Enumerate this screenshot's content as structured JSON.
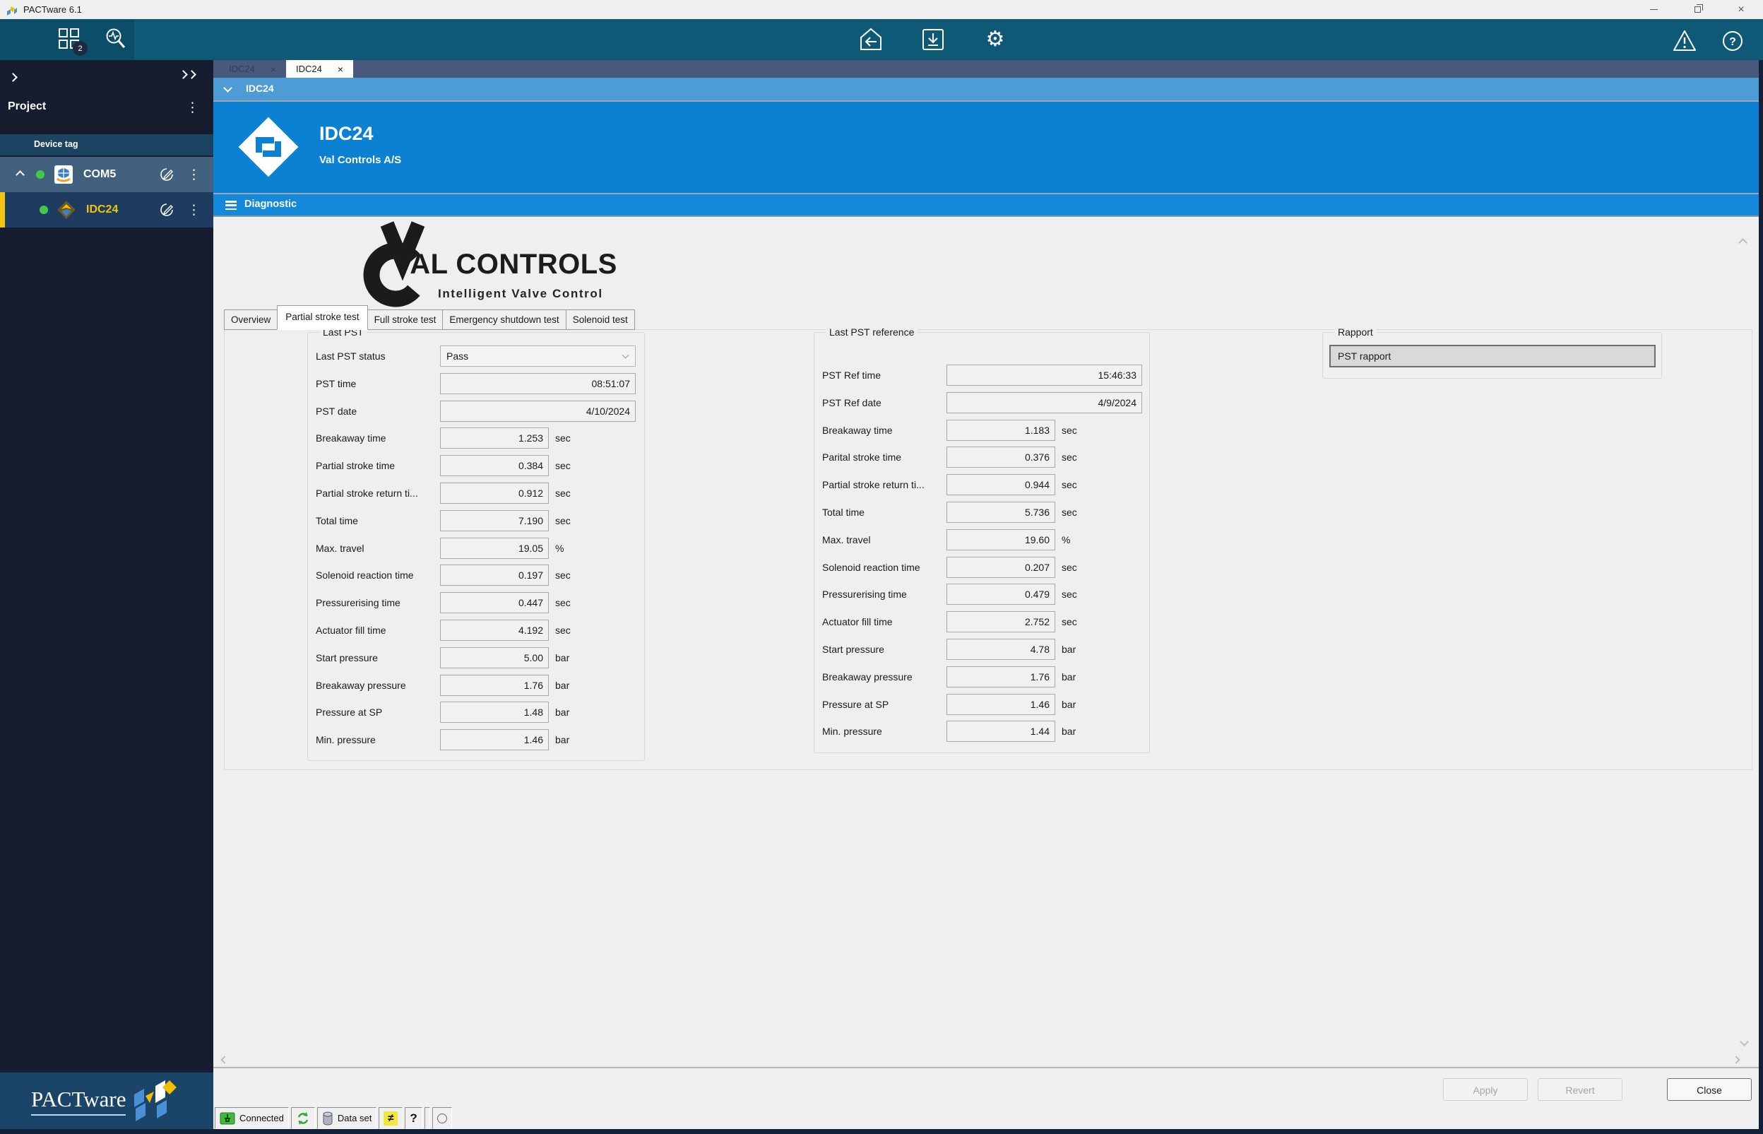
{
  "window": {
    "title": "PACTware 6.1"
  },
  "toolbar": {
    "topology_badge": "2",
    "gear_glyph": "⚙",
    "help_glyph": "?"
  },
  "sidebar": {
    "project_label": "Project",
    "device_tag_label": "Device tag",
    "nodes": [
      {
        "label": "COM5"
      },
      {
        "label": "IDC24"
      }
    ],
    "logo_text": "PACTware"
  },
  "doc_tabs": [
    {
      "label": "IDC24",
      "close": "×",
      "active": false
    },
    {
      "label": "IDC24",
      "close": "×",
      "active": true
    }
  ],
  "device_panel": {
    "collapse_label": "IDC24",
    "title": "IDC24",
    "vendor": "Val Controls A/S",
    "menu_label": "Diagnostic"
  },
  "brand": {
    "title": "VAL CONTROLS",
    "tagline": "Intelligent Valve Control"
  },
  "tabs": [
    {
      "label": "Overview",
      "active": false
    },
    {
      "label": "Partial stroke test",
      "active": true
    },
    {
      "label": "Full stroke test",
      "active": false
    },
    {
      "label": "Emergency shutdown test",
      "active": false
    },
    {
      "label": "Solenoid test",
      "active": false
    }
  ],
  "last_pst": {
    "title": "Last PST",
    "status_label": "Last PST status",
    "status_value": "Pass",
    "rows": [
      {
        "label": "PST time",
        "value": "08:51:07",
        "unit": "",
        "wide": true
      },
      {
        "label": "PST date",
        "value": "4/10/2024",
        "unit": "",
        "wide": true
      },
      {
        "label": "Breakaway time",
        "value": "1.253",
        "unit": "sec"
      },
      {
        "label": "Partial stroke time",
        "value": "0.384",
        "unit": "sec"
      },
      {
        "label": "Partial stroke return ti...",
        "value": "0.912",
        "unit": "sec"
      },
      {
        "label": "Total time",
        "value": "7.190",
        "unit": "sec"
      },
      {
        "label": "Max. travel",
        "value": "19.05",
        "unit": "%"
      },
      {
        "label": "Solenoid reaction time",
        "value": "0.197",
        "unit": "sec"
      },
      {
        "label": "Pressurerising time",
        "value": "0.447",
        "unit": "sec"
      },
      {
        "label": "Actuator fill time",
        "value": "4.192",
        "unit": "sec"
      },
      {
        "label": "Start pressure",
        "value": "5.00",
        "unit": "bar"
      },
      {
        "label": "Breakaway pressure",
        "value": "1.76",
        "unit": "bar"
      },
      {
        "label": "Pressure at SP",
        "value": "1.48",
        "unit": "bar"
      },
      {
        "label": "Min. pressure",
        "value": "1.46",
        "unit": "bar"
      }
    ]
  },
  "reference": {
    "title": "Last PST reference",
    "rows": [
      {
        "label": "PST Ref time",
        "value": "15:46:33",
        "unit": "",
        "wide": true
      },
      {
        "label": "PST Ref date",
        "value": "4/9/2024",
        "unit": "",
        "wide": true
      },
      {
        "label": "Breakaway time",
        "value": "1.183",
        "unit": "sec"
      },
      {
        "label": "Parital stroke time",
        "value": "0.376",
        "unit": "sec"
      },
      {
        "label": "Partial stroke return ti...",
        "value": "0.944",
        "unit": "sec"
      },
      {
        "label": "Total time",
        "value": "5.736",
        "unit": "sec"
      },
      {
        "label": "Max. travel",
        "value": "19.60",
        "unit": "%"
      },
      {
        "label": "Solenoid reaction time",
        "value": "0.207",
        "unit": "sec"
      },
      {
        "label": "Pressurerising time",
        "value": "0.479",
        "unit": "sec"
      },
      {
        "label": "Actuator fill time",
        "value": "2.752",
        "unit": "sec"
      },
      {
        "label": "Start pressure",
        "value": "4.78",
        "unit": "bar"
      },
      {
        "label": "Breakaway pressure",
        "value": "1.76",
        "unit": "bar"
      },
      {
        "label": "Pressure at SP",
        "value": "1.46",
        "unit": "bar"
      },
      {
        "label": "Min. pressure",
        "value": "1.44",
        "unit": "bar"
      }
    ]
  },
  "rapport": {
    "title": "Rapport",
    "button_label": "PST rapport"
  },
  "footer": {
    "apply": "Apply",
    "revert": "Revert",
    "close": "Close"
  },
  "statusbar": {
    "connected_label": "Connected",
    "dataset_label": "Data set",
    "not_equal_glyph": "≠",
    "help_glyph": "?"
  }
}
